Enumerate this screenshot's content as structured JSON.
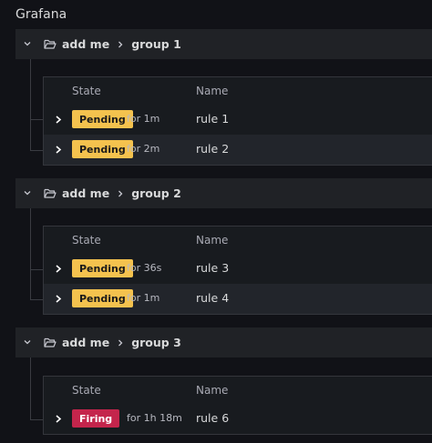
{
  "app_title": "Grafana",
  "columns": {
    "state": "State",
    "name": "Name"
  },
  "groups": [
    {
      "namespace": "add me",
      "group": "group 1",
      "rules": [
        {
          "state": "Pending",
          "for": "for 1m",
          "name": "rule 1"
        },
        {
          "state": "Pending",
          "for": "for 2m",
          "name": "rule 2"
        }
      ]
    },
    {
      "namespace": "add me",
      "group": "group 2",
      "rules": [
        {
          "state": "Pending",
          "for": "for 36s",
          "name": "rule 3"
        },
        {
          "state": "Pending",
          "for": "for 1m",
          "name": "rule 4"
        }
      ]
    },
    {
      "namespace": "add me",
      "group": "group 3",
      "rules": [
        {
          "state": "Firing",
          "for": "for 1h 18m",
          "name": "rule 6"
        }
      ]
    }
  ],
  "colors": {
    "pending": "#f4c24e",
    "firing": "#c4254c",
    "background": "#111217"
  }
}
